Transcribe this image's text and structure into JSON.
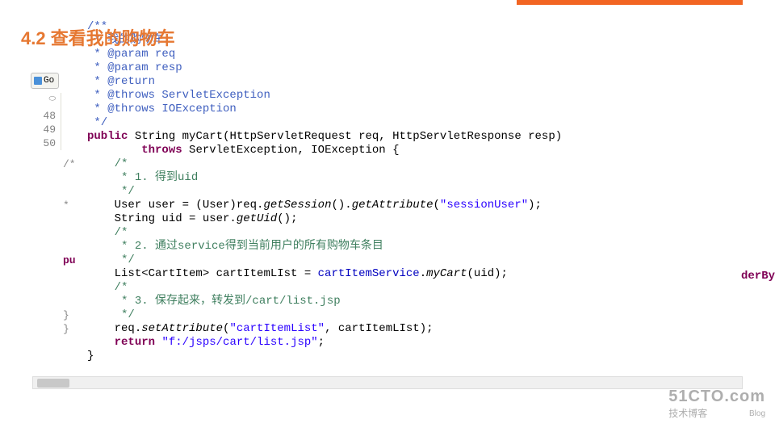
{
  "heading": "4.2 查看我的购物车",
  "tab_label": "Go",
  "line_numbers": {
    "ln48": "48",
    "ln49": "49",
    "ln50": "50"
  },
  "left_markers": {
    "m1": "/*",
    "m2": " *",
    "m3": " *",
    "m4": "pu"
  },
  "right_fragment": "derBy",
  "jd": {
    "l1": "/**",
    "l2": " * 我的购物车",
    "l3": " * @param",
    "l3r": " req",
    "l4": " * @param",
    "l4r": " resp",
    "l5": " * @return",
    "l6": " * @throws",
    "l6r": " ServletException",
    "l7": " * @throws",
    "l7r": " IOException",
    "l8": " */"
  },
  "kw": {
    "public": "public",
    "throws": "throws",
    "return": "return"
  },
  "sig": {
    "type_string": " String ",
    "method": "myCart",
    "params": "(HttpServletRequest req, HttpServletResponse resp)",
    "throws_line": " ServletException, IOException {"
  },
  "c1": {
    "l1": "/*",
    "l2": " * 1. 得到uid",
    "l3": " */"
  },
  "line_user": {
    "a": "User user = (User)req.",
    "b": "getSession",
    "c": "().",
    "d": "getAttribute",
    "e": "(",
    "f": "\"sessionUser\"",
    "g": ");"
  },
  "line_uid": {
    "a": "String uid = user.",
    "b": "getUid",
    "c": "();"
  },
  "c2": {
    "l1": "/*",
    "l2": " * 2. 通过service得到当前用户的所有购物车条目",
    "l3": " */"
  },
  "line_list": {
    "a": "List<CartItem> cartItemLIst = ",
    "b": "cartItemService",
    "c": ".",
    "d": "myCart",
    "e": "(uid);"
  },
  "c3": {
    "l1": "/*",
    "l2": " * 3. 保存起来，转发到/cart/list.jsp",
    "l3": " */"
  },
  "line_set": {
    "a": "req.",
    "b": "setAttribute",
    "c": "(",
    "d": "\"cartItemList\"",
    "e": ", cartItemLIst);"
  },
  "line_ret": {
    "a": " ",
    "b": "\"f:/jsps/cart/list.jsp\"",
    "c": ";"
  },
  "brace1": "}",
  "brace2": "}",
  "watermark": {
    "big": "51CTO.com",
    "small": "技术博客",
    "blog": "Blog"
  }
}
